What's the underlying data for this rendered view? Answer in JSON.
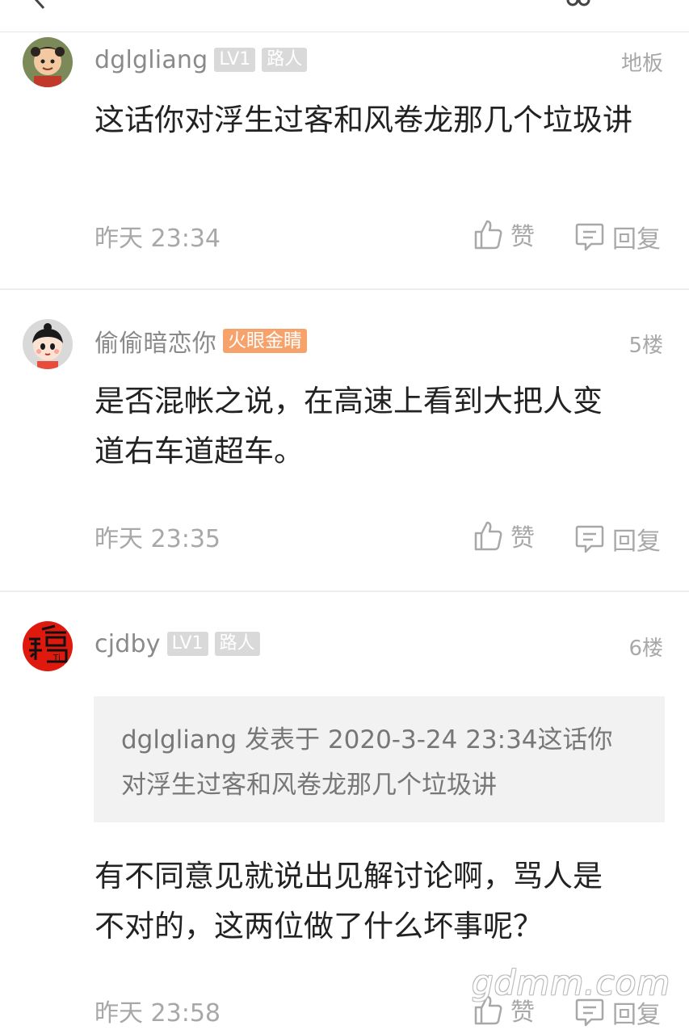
{
  "comments": [
    {
      "username": "dglgliang",
      "badges": [
        "LV1",
        "路人"
      ],
      "floor": "地板",
      "content": "这话你对浮生过客和风卷龙那几个垃圾讲",
      "time": "昨天 23:34",
      "like_label": "赞",
      "reply_label": "回复"
    },
    {
      "username": "偷偷暗恋你",
      "badges": [
        "火眼金睛"
      ],
      "floor": "5楼",
      "content": "是否混帐之说，在高速上看到大把人变道右车道超车。",
      "time": "昨天 23:35",
      "like_label": "赞",
      "reply_label": "回复"
    },
    {
      "username": "cjdby",
      "badges": [
        "LV1",
        "路人"
      ],
      "floor": "6楼",
      "quote": "dglgliang 发表于 2020-3-24 23:34这话你对浮生过客和风卷龙那几个垃圾讲",
      "content": "有不同意见就说出见解讨论啊，骂人是不对的，这两位做了什么坏事呢？",
      "time": "昨天 23:58",
      "like_label": "赞",
      "reply_label": "回复"
    }
  ],
  "watermark": "gdmm.com",
  "colors": {
    "muted_text": "#a8a8a8",
    "badge_gray": "#d9d9d9",
    "badge_orange": "#f7a26b",
    "quote_bg": "#f2f2f2"
  }
}
